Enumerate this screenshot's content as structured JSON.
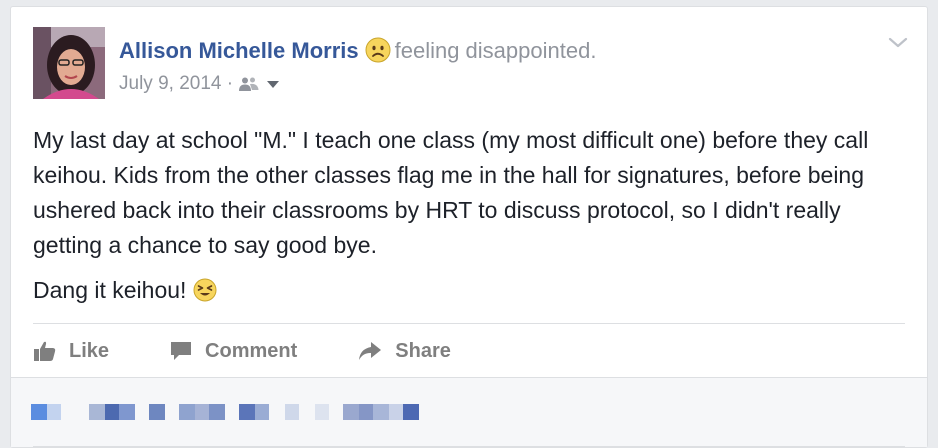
{
  "post": {
    "author": "Allison Michelle Morris",
    "feeling": "feeling disappointed.",
    "date": "July 9, 2014",
    "separator": "·",
    "audience_icon": "friends-icon",
    "body": [
      "My last day at school \"M.\" I teach one class (my most difficult one) before they call keihou. Kids from the other classes flag me in the hall for signatures, before being ushered back into their classrooms by HRT to discuss protocol, so I didn't really getting a chance to say good bye.",
      "Dang it keihou!"
    ]
  },
  "actions": {
    "like": "Like",
    "comment": "Comment",
    "share": "Share"
  },
  "colors": {
    "author": "#365899",
    "muted": "#90949c",
    "text": "#1d2129",
    "action": "#7f7f7f",
    "background": "#e9ebee",
    "emoji_yellow": "#f7d55d"
  }
}
